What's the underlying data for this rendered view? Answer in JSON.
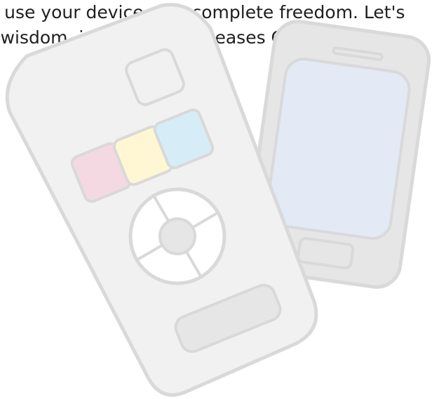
{
  "intro_text": {
    "line_1": "an use your device with complete freedom. Let's",
    "line_2": "th wisdom, in a way that pleases God."
  },
  "illustration": {
    "remote_icon": "remote-control-icon",
    "phone_icon": "smartphone-icon",
    "colors": {
      "outline": "#d9d9d9",
      "body_fill": "#f1f1f1",
      "phone_fill": "#e6e6e6",
      "phone_screen": "#e3e9f5",
      "button_red": "#f5d9e2",
      "button_yellow": "#fff7d4",
      "button_blue": "#d6edf7",
      "dpad_center": "#e6e6e6",
      "bottom_button": "#e6e6e6"
    }
  }
}
